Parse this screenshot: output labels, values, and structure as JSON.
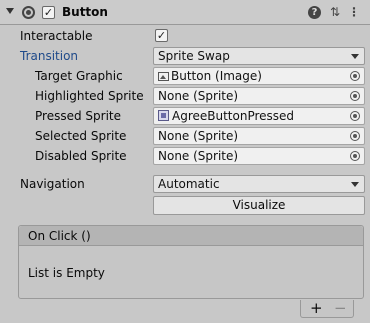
{
  "header": {
    "title": "Button",
    "enabled_check": "✓",
    "help_glyph": "?",
    "settings_glyph": "⇅",
    "menu_glyph": "⋮"
  },
  "fields": {
    "interactable": {
      "label": "Interactable",
      "check": "✓"
    },
    "transition": {
      "label": "Transition",
      "value": "Sprite Swap"
    },
    "target_graphic": {
      "label": "Target Graphic",
      "value": "Button (Image)"
    },
    "highlighted_sprite": {
      "label": "Highlighted Sprite",
      "value": "None (Sprite)"
    },
    "pressed_sprite": {
      "label": "Pressed Sprite",
      "value": "AgreeButtonPressed"
    },
    "selected_sprite": {
      "label": "Selected Sprite",
      "value": "None (Sprite)"
    },
    "disabled_sprite": {
      "label": "Disabled Sprite",
      "value": "None (Sprite)"
    },
    "navigation": {
      "label": "Navigation",
      "value": "Automatic"
    },
    "visualize_label": "Visualize"
  },
  "on_click": {
    "title": "On Click ()",
    "empty_text": "List is Empty",
    "add_glyph": "+",
    "remove_glyph": "−"
  },
  "colors": {
    "panel_bg": "#c8c8c8",
    "transition_label": "#1f4a8a",
    "field_bg": "#f0f0f0"
  }
}
